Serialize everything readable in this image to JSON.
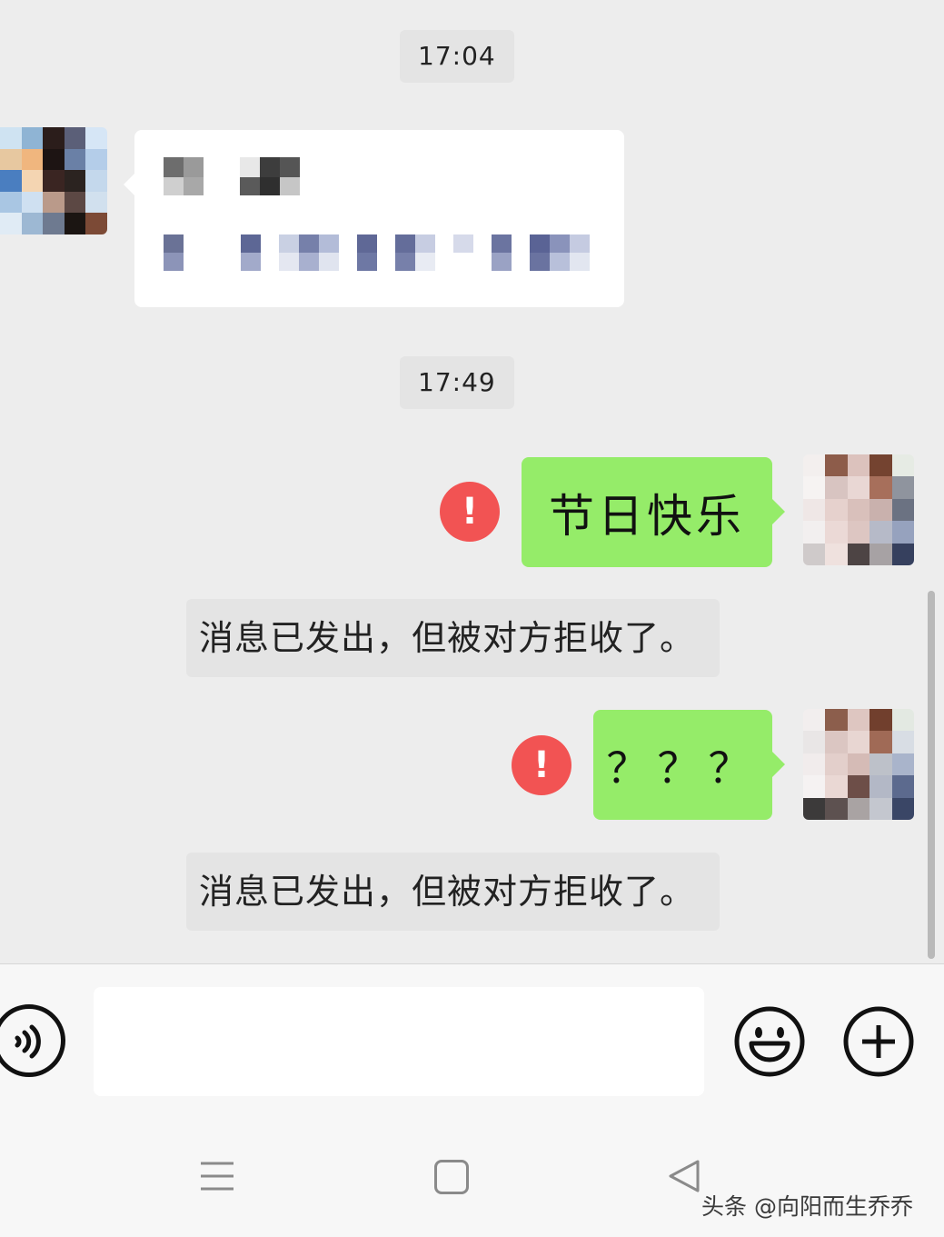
{
  "chat": {
    "timestamps": [
      "17:04",
      "17:49"
    ],
    "messages": [
      {
        "direction": "incoming",
        "content": "",
        "note": ""
      },
      {
        "direction": "outgoing",
        "text": "节日快乐",
        "status": "failed"
      },
      {
        "direction": "system",
        "text": "消息已发出，但被对方拒收了。"
      },
      {
        "direction": "outgoing",
        "text": "？？？",
        "status": "failed"
      },
      {
        "direction": "system",
        "text": "消息已发出，但被对方拒收了。"
      }
    ],
    "error_icon_glyph": "!"
  },
  "input_bar": {
    "placeholder": "",
    "voice_icon": "voice-icon",
    "emoji_icon": "emoji-icon",
    "plus_icon": "plus-icon"
  },
  "nav_bar": {
    "icons": [
      "menu-icon",
      "home-icon",
      "back-icon"
    ]
  },
  "watermark": "头条 @向阳而生乔乔",
  "colors": {
    "background": "#ededed",
    "outgoing_bubble": "#95ec69",
    "incoming_bubble": "#ffffff",
    "error": "#f25353",
    "system_note": "#e4e4e4"
  }
}
